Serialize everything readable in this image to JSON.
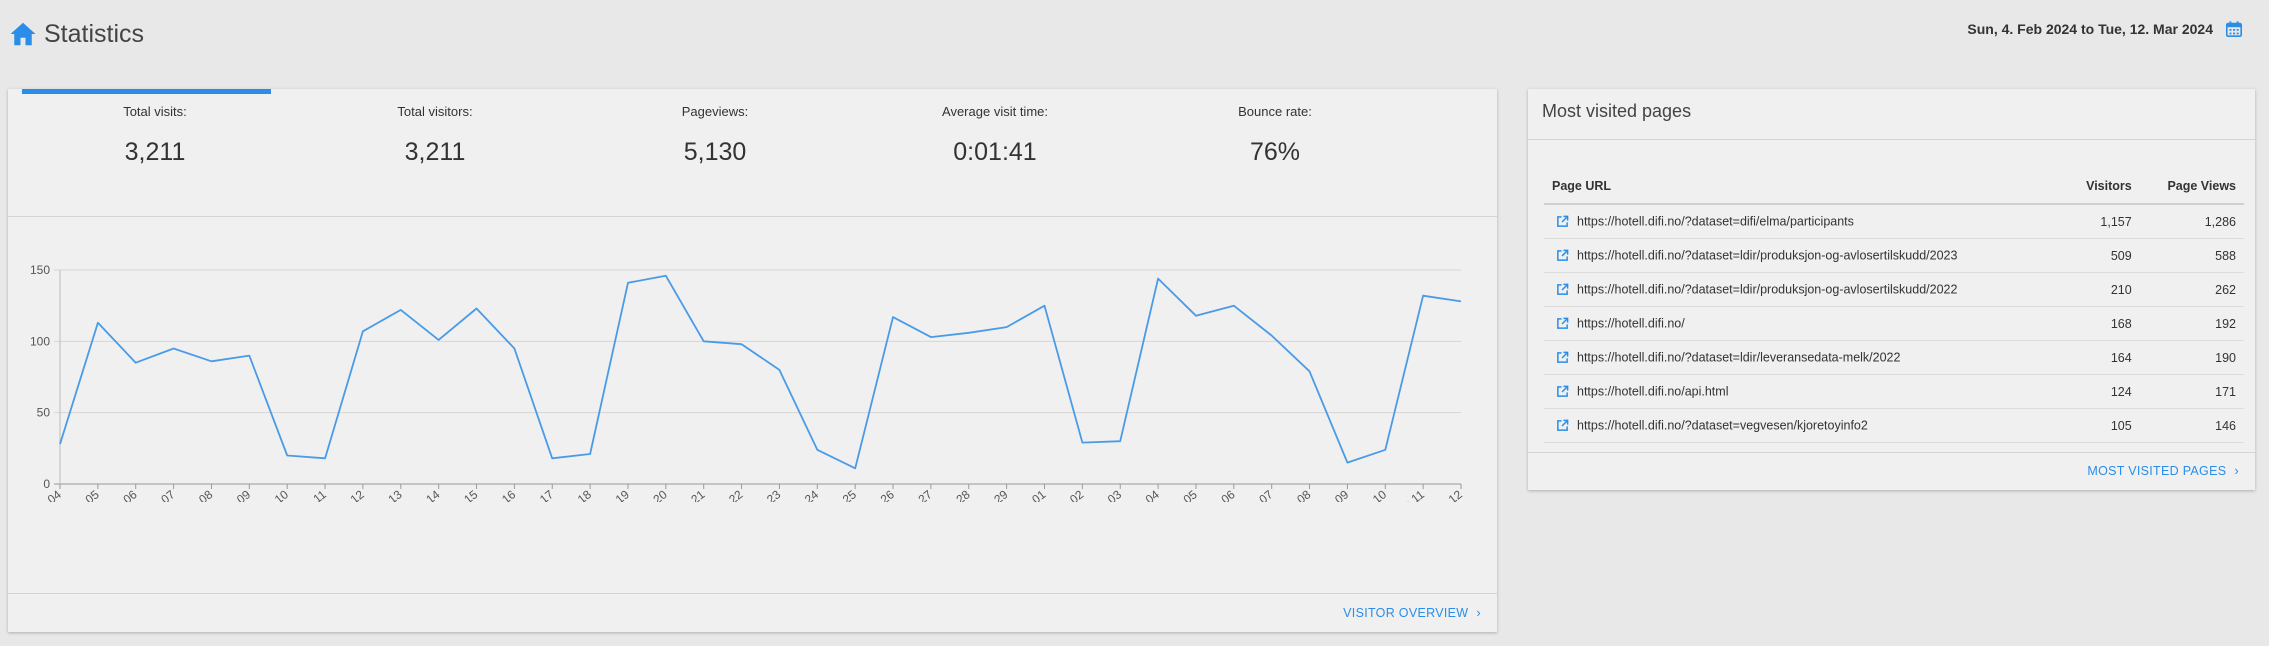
{
  "header": {
    "title": "Statistics",
    "daterange": "Sun, 4. Feb 2024 to Tue, 12. Mar 2024"
  },
  "icons": {
    "home": "home-icon",
    "calendar": "calendar-icon",
    "external": "external-link-icon",
    "chevron": "chevron-right-icon"
  },
  "colors": {
    "accent": "#2a8de8",
    "line": "#4a9be6"
  },
  "kpis": [
    {
      "label": "Total visits:",
      "value": "3,211"
    },
    {
      "label": "Total visitors:",
      "value": "3,211"
    },
    {
      "label": "Pageviews:",
      "value": "5,130"
    },
    {
      "label": "Average visit time:",
      "value": "0:01:41"
    },
    {
      "label": "Bounce rate:",
      "value": "76%"
    }
  ],
  "chart_data": {
    "type": "line",
    "x": [
      "feb. 04",
      "feb. 05",
      "feb. 06",
      "feb. 07",
      "feb. 08",
      "feb. 09",
      "feb. 10",
      "feb. 11",
      "feb. 12",
      "feb. 13",
      "feb. 14",
      "feb. 15",
      "feb. 16",
      "feb. 17",
      "feb. 18",
      "feb. 19",
      "feb. 20",
      "feb. 21",
      "feb. 22",
      "feb. 23",
      "feb. 24",
      "feb. 25",
      "feb. 26",
      "feb. 27",
      "feb. 28",
      "feb. 29",
      "mars 01",
      "mars 02",
      "mars 03",
      "mars 04",
      "mars 05",
      "mars 06",
      "mars 07",
      "mars 08",
      "mars 09",
      "mars 10",
      "mars 11",
      "mars 12"
    ],
    "series": [
      {
        "values": [
          28,
          113,
          85,
          95,
          86,
          90,
          20,
          18,
          107,
          122,
          101,
          123,
          95,
          18,
          21,
          141,
          146,
          100,
          98,
          80,
          24,
          11,
          117,
          103,
          106,
          110,
          125,
          29,
          30,
          144,
          118,
          125,
          104,
          79,
          15,
          24,
          132,
          128
        ]
      }
    ],
    "yticks": [
      0,
      50,
      100,
      150
    ],
    "ylim": [
      0,
      150
    ],
    "grid": true,
    "xlabel": "",
    "ylabel": ""
  },
  "visits_footer": {
    "label": "VISITOR OVERVIEW"
  },
  "pages": {
    "title": "Most visited pages",
    "columns": [
      "Page URL",
      "Visitors",
      "Page Views"
    ],
    "rows": [
      {
        "url": "https://hotell.difi.no/?dataset=difi/elma/participants",
        "visitors": "1,157",
        "views": "1,286"
      },
      {
        "url": "https://hotell.difi.no/?dataset=ldir/produksjon-og-avlosertilskudd/2023",
        "visitors": "509",
        "views": "588"
      },
      {
        "url": "https://hotell.difi.no/?dataset=ldir/produksjon-og-avlosertilskudd/2022",
        "visitors": "210",
        "views": "262"
      },
      {
        "url": "https://hotell.difi.no/",
        "visitors": "168",
        "views": "192"
      },
      {
        "url": "https://hotell.difi.no/?dataset=ldir/leveransedata-melk/2022",
        "visitors": "164",
        "views": "190"
      },
      {
        "url": "https://hotell.difi.no/api.html",
        "visitors": "124",
        "views": "171"
      },
      {
        "url": "https://hotell.difi.no/?dataset=vegvesen/kjoretoyinfo2",
        "visitors": "105",
        "views": "146"
      }
    ],
    "footer_label": "MOST VISITED PAGES"
  }
}
